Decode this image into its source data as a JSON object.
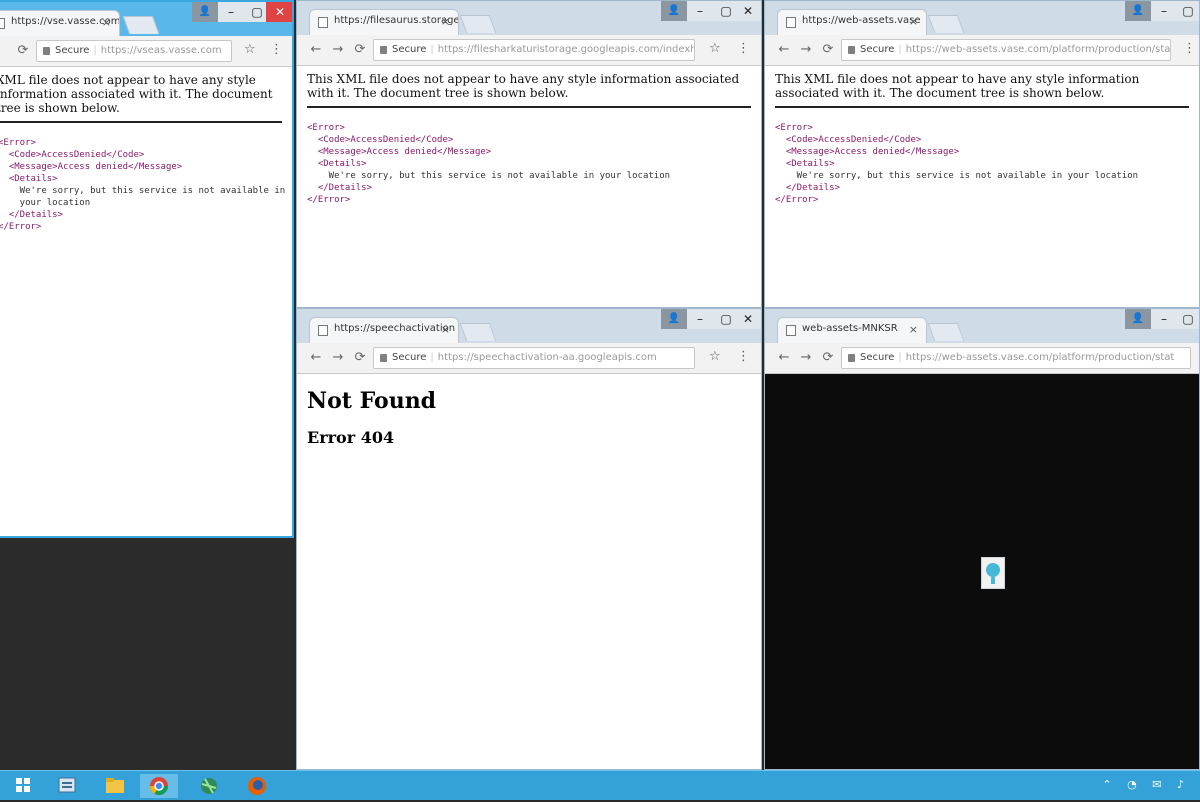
{
  "windows": {
    "w1": {
      "tab_title": "https://vse.vasse.com",
      "url": "https://vseas.vasse.com",
      "secure": "Secure",
      "xml_note": "XML file does not appear to have any style information associated with it. The document tree is shown below.",
      "xml_lines": [
        "<Error>",
        "  <Code>AccessDenied</Code>",
        "  <Message>Access denied</Message>",
        "  <Details>",
        "    We're sorry, but this service is not available in",
        "    your location",
        "  </Details>",
        "</Error>"
      ]
    },
    "w2": {
      "tab_title": "https://filesaurus.storage",
      "url": "https://filesharkaturistorage.googleapis.com/indexhtm",
      "secure": "Secure",
      "xml_note": "This XML file does not appear to have any style information associated with it. The document tree is shown below.",
      "xml_lines": [
        "<Error>",
        "  <Code>AccessDenied</Code>",
        "  <Message>Access denied</Message>",
        "  <Details>",
        "    We're sorry, but this service is not available in your location",
        "  </Details>",
        "</Error>"
      ]
    },
    "w3": {
      "tab_title": "https://web-assets.vase",
      "url": "https://web-assets.vase.com/platform/production/stat",
      "secure": "Secure",
      "xml_note": "This XML file does not appear to have any style information associated with it. The document tree is shown below.",
      "xml_lines": [
        "<Error>",
        "  <Code>AccessDenied</Code>",
        "  <Message>Access denied</Message>",
        "  <Details>",
        "    We're sorry, but this service is not available in your location",
        "  </Details>",
        "</Error>"
      ]
    },
    "w4": {
      "tab_title": "https://speechactivation",
      "url": "https://speechactivation-aa.googleapis.com",
      "secure": "Secure",
      "heading": "Not Found",
      "error": "Error 404"
    },
    "w5": {
      "tab_title": "web-assets-MNKSR",
      "url": "https://web-assets.vase.com/platform/production/stat",
      "secure": "Secure"
    }
  },
  "chrome": {
    "minimize": "–",
    "maximize": "▢",
    "close": "✕",
    "user": "👤",
    "tab_close": "×",
    "back": "←",
    "forward": "→",
    "reload": "⟳",
    "star": "☆",
    "menu": "⋮"
  },
  "taskbar": {
    "icons": [
      "start-icon",
      "server-manager-icon",
      "file-explorer-icon",
      "chrome-icon",
      "network-globe-icon",
      "firefox-icon"
    ],
    "tray": "⌃ ◔ ✉ ♪"
  }
}
